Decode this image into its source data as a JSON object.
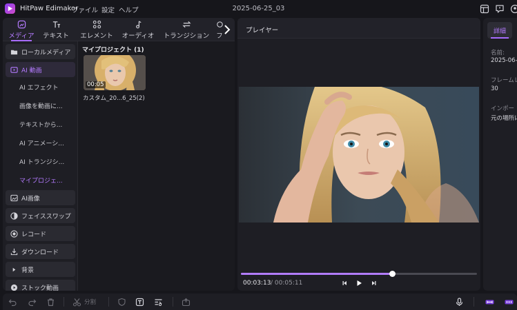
{
  "app": {
    "name": "HitPaw Edimakor",
    "menu": [
      "ファイル",
      "設定",
      "ヘルプ"
    ],
    "document_title": "2025-06-25_03"
  },
  "tabs": [
    {
      "label": "メディア",
      "icon": "media-icon",
      "active": true
    },
    {
      "label": "テキスト",
      "icon": "text-icon",
      "active": false
    },
    {
      "label": "エレメント",
      "icon": "element-icon",
      "active": false
    },
    {
      "label": "オーディオ",
      "icon": "audio-icon",
      "active": false
    },
    {
      "label": "トランジション",
      "icon": "transition-icon",
      "active": false
    },
    {
      "label": "フ",
      "icon": "filter-icon",
      "active": false
    }
  ],
  "sidebar": {
    "items": [
      {
        "label": "ローカルメディア",
        "icon": "folder-icon"
      },
      {
        "label": "AI 動画",
        "icon": "ai-video-icon",
        "active": true
      },
      {
        "label": "AI画像",
        "icon": "ai-image-icon"
      },
      {
        "label": "フェイススワップ",
        "icon": "face-swap-icon"
      },
      {
        "label": "レコード",
        "icon": "record-icon"
      },
      {
        "label": "ダウンロード",
        "icon": "download-icon"
      },
      {
        "label": "背景",
        "icon": "triangle-right-icon"
      },
      {
        "label": "ストック動画",
        "icon": "play-circle-icon"
      }
    ],
    "sub_items": [
      {
        "label": "AI エフェクト"
      },
      {
        "label": "画像を動画に..."
      },
      {
        "label": "テキストから..."
      },
      {
        "label": "AI アニメーシ..."
      },
      {
        "label": "AI トランジシ..."
      },
      {
        "label": "マイプロジェ...",
        "active": true
      }
    ]
  },
  "media": {
    "heading": "マイプロジェクト (1)",
    "items": [
      {
        "duration": "00:05",
        "name": "カスタム_20...6_25(2)"
      }
    ]
  },
  "player": {
    "title": "プレイヤー",
    "current_time": "00:03:13",
    "total_time": "/ 00:05:11",
    "progress": 0.64
  },
  "details": {
    "tab_label": "詳細",
    "fields": [
      {
        "label": "名前:",
        "value": "2025-06-"
      },
      {
        "label": "フレームレ",
        "value": "30"
      },
      {
        "label": "インポー",
        "value": "元の場所に"
      }
    ]
  },
  "toolbar": {
    "split_label": "分割"
  },
  "colors": {
    "accent": "#a86cff",
    "background": "#16161b",
    "panel": "#1e1e24"
  }
}
